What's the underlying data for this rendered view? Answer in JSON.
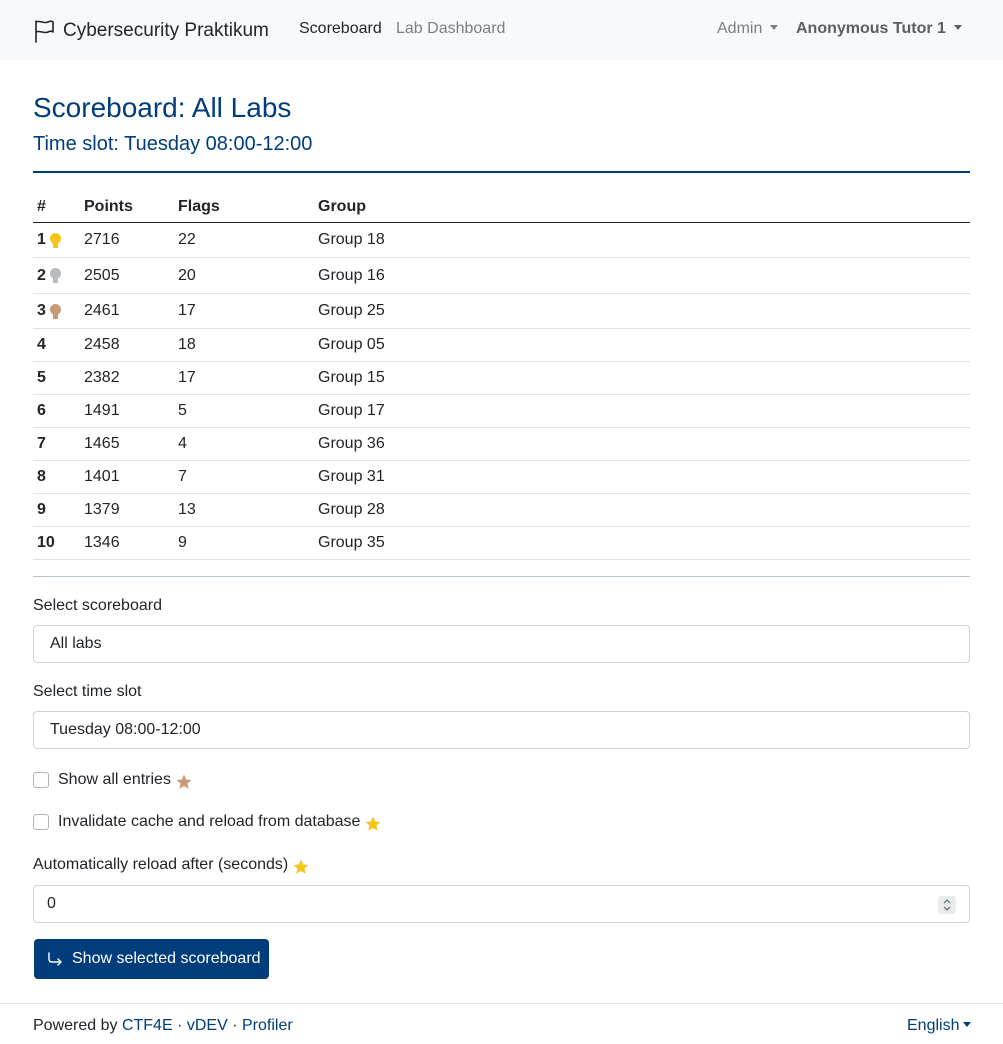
{
  "navbar": {
    "brand": "Cybersecurity Praktikum",
    "brand_icon": "flag-icon",
    "links": [
      {
        "label": "Scoreboard",
        "active": true
      },
      {
        "label": "Lab Dashboard",
        "active": false
      }
    ],
    "admin_menu": "Admin",
    "user_menu": "Anonymous Tutor 1"
  },
  "page": {
    "title": "Scoreboard: All Labs",
    "subtitle": "Time slot: Tuesday 08:00-12:00"
  },
  "table": {
    "headers": [
      "#",
      "Points",
      "Flags",
      "Group"
    ],
    "rows": [
      {
        "rank": "1",
        "points": "2716",
        "flags": "22",
        "group": "Group 18",
        "medal": "gold-medal-icon"
      },
      {
        "rank": "2",
        "points": "2505",
        "flags": "20",
        "group": "Group 16",
        "medal": "silver-medal-icon"
      },
      {
        "rank": "3",
        "points": "2461",
        "flags": "17",
        "group": "Group 25",
        "medal": "bronze-medal-icon"
      },
      {
        "rank": "4",
        "points": "2458",
        "flags": "18",
        "group": "Group 05"
      },
      {
        "rank": "5",
        "points": "2382",
        "flags": "17",
        "group": "Group 15"
      },
      {
        "rank": "6",
        "points": "1491",
        "flags": "5",
        "group": "Group 17"
      },
      {
        "rank": "7",
        "points": "1465",
        "flags": "4",
        "group": "Group 36"
      },
      {
        "rank": "8",
        "points": "1401",
        "flags": "7",
        "group": "Group 31"
      },
      {
        "rank": "9",
        "points": "1379",
        "flags": "13",
        "group": "Group 28"
      },
      {
        "rank": "10",
        "points": "1346",
        "flags": "9",
        "group": "Group 35"
      }
    ]
  },
  "form": {
    "scoreboard_label": "Select scoreboard",
    "scoreboard_value": "All labs",
    "timeslot_label": "Select time slot",
    "timeslot_value": "Tuesday 08:00-12:00",
    "show_all_label": "Show all entries",
    "show_all_checked": false,
    "invalidate_label": "Invalidate cache and reload from database",
    "invalidate_checked": false,
    "reload_label": "Automatically reload after (seconds)",
    "reload_value": "0",
    "submit_label": "Show selected scoreboard"
  },
  "footer": {
    "powered_by": "Powered by",
    "link_ctf": "CTF4E",
    "link_version": "vDEV",
    "link_profiler": "Profiler",
    "separator": "·",
    "language": "English"
  },
  "colors": {
    "primary": "#003d7a",
    "gold": "#f5c518",
    "silver": "#b8bcc1",
    "bronze": "#c99a78"
  }
}
